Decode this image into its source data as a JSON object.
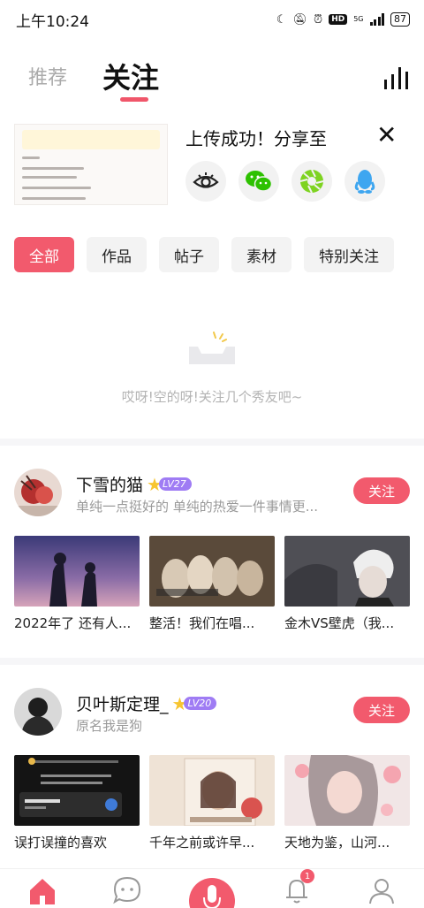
{
  "status_bar": {
    "time": "上午10:24",
    "network_label": "5G",
    "battery": "87"
  },
  "top_tabs": {
    "recommend": "推荐",
    "following": "关注"
  },
  "upload_banner": {
    "title": "上传成功！分享至",
    "share_targets": [
      "eye-icon",
      "wechat-icon",
      "moments-icon",
      "qq-icon"
    ]
  },
  "filters": [
    "全部",
    "作品",
    "帖子",
    "素材",
    "特别关注"
  ],
  "empty_state": {
    "text": "哎呀!空的呀!关注几个秀友吧~"
  },
  "recommended_users": [
    {
      "name": "下雪的猫",
      "level": "LV27",
      "subtitle": "单纯一点挺好的 单纯的热爱一件事情更...",
      "follow_label": "关注",
      "works": [
        {
          "title": "2022年了 还有人..."
        },
        {
          "title": "整活！我们在唱..."
        },
        {
          "title": "金木VS壁虎（我..."
        }
      ]
    },
    {
      "name": "贝叶斯定理_",
      "level": "LV20",
      "subtitle": "原名我是狗",
      "follow_label": "关注",
      "works": [
        {
          "title": "误打误撞的喜欢"
        },
        {
          "title": "千年之前或许早..."
        },
        {
          "title": "天地为鉴，山河..."
        }
      ]
    }
  ],
  "bottom_nav": {
    "notification_count": "1"
  },
  "colors": {
    "accent": "#f25a6d",
    "level_badge": "#9f7cf4",
    "star": "#f7c531"
  }
}
